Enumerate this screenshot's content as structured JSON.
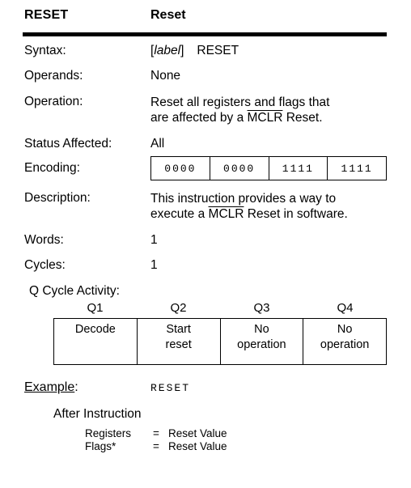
{
  "header": {
    "mnemonic": "RESET",
    "name": "Reset"
  },
  "fields": [
    {
      "label": "Syntax:",
      "value": "[ label ]   RESET"
    },
    {
      "label": "Operands:",
      "value": "None"
    },
    {
      "label": "Operation:",
      "value": "Reset all registers and flags that are affected by a MCLR Reset."
    },
    {
      "label": "Status Affected:",
      "value": "All"
    },
    {
      "label": "Encoding:",
      "value": ""
    },
    {
      "label": "Description:",
      "value": "This instruction provides a way to execute a MCLR Reset in software."
    },
    {
      "label": "Words:",
      "value": "1"
    },
    {
      "label": "Cycles:",
      "value": "1"
    }
  ],
  "syntax": {
    "bracket_open": "[",
    "operand": "label",
    "bracket_close": "]",
    "mnemonic": "RESET"
  },
  "operation": {
    "line1_pre": "Reset all registers and flags that",
    "line2_pre": "are affected by a ",
    "overlined": "MCLR",
    "line2_post": " Reset."
  },
  "description": {
    "line1": "This instruction provides a way to",
    "line2_pre": "execute a ",
    "overlined": "MCLR",
    "line2_post": " Reset in software."
  },
  "encoding": {
    "label": "Encoding:",
    "cells": [
      "0000",
      "0000",
      "1111",
      "1111"
    ]
  },
  "q_cycle": {
    "title": "Q Cycle Activity:",
    "headers": [
      "Q1",
      "Q2",
      "Q3",
      "Q4"
    ],
    "cells": [
      {
        "line1": "Decode",
        "line2": ""
      },
      {
        "line1": "Start",
        "line2": "reset"
      },
      {
        "line1": "No",
        "line2": "operation"
      },
      {
        "line1": "No",
        "line2": "operation"
      }
    ]
  },
  "example": {
    "label_underlined": "Example",
    "label_colon": ":",
    "code": "RESET",
    "after_instruction_title": "After Instruction",
    "rows": [
      {
        "key": "Registers",
        "eq": "=",
        "value": "Reset Value"
      },
      {
        "key": "Flags*",
        "eq": "=",
        "value": "Reset Value"
      }
    ]
  },
  "colors": {
    "background": "#ffffff",
    "text": "#000000",
    "rule": "#000000",
    "table_border": "#000000"
  }
}
